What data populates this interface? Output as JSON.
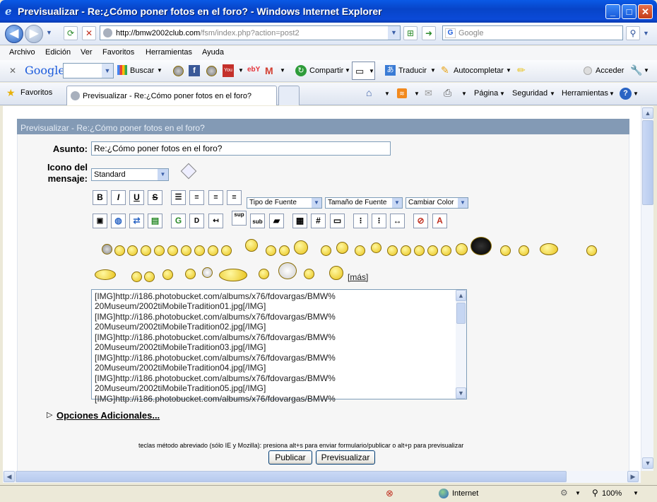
{
  "window": {
    "title": "Previsualizar - Re:¿Cómo poner fotos en el foro? - Windows Internet Explorer"
  },
  "address": {
    "url_host": "http://bmw2002club.com",
    "url_path": "/fsm/index.php?action=post2",
    "search_placeholder": "Google"
  },
  "menu": [
    "Archivo",
    "Edición",
    "Ver",
    "Favoritos",
    "Herramientas",
    "Ayuda"
  ],
  "google_toolbar": {
    "logo": "Google",
    "search": "Buscar",
    "share": "Compartir",
    "translate": "Traducir",
    "autofill": "Autocompletar",
    "signin": "Acceder"
  },
  "favorites_bar": {
    "favorites": "Favoritos",
    "tab_title": "Previsualizar - Re:¿Cómo poner fotos en el foro?",
    "page": "Página",
    "security": "Seguridad",
    "tools": "Herramientas"
  },
  "form": {
    "header": "Previsualizar - Re:¿Cómo poner fotos en el foro?",
    "subject_label": "Asunto:",
    "subject_value": "Re:¿Cómo poner fotos en el foro?",
    "icon_label_1": "Icono del",
    "icon_label_2": "mensaje:",
    "icon_value": "Standard",
    "font_type": "Tipo de Fuente",
    "font_size": "Tamaño de Fuente",
    "font_color": "Cambiar Color",
    "more_smileys": "[más]",
    "message_lines": [
      "[IMG]http://i186.photobucket.com/albums/x76/fdovargas/BMW%",
      "20Museum/2002tiMobileTradition01.jpg[/IMG]",
      "[IMG]http://i186.photobucket.com/albums/x76/fdovargas/BMW%",
      "20Museum/2002tiMobileTradition02.jpg[/IMG]",
      "[IMG]http://i186.photobucket.com/albums/x76/fdovargas/BMW%",
      "20Museum/2002tiMobileTradition03.jpg[/IMG]",
      "[IMG]http://i186.photobucket.com/albums/x76/fdovargas/BMW%",
      "20Museum/2002tiMobileTradition04.jpg[/IMG]",
      "[IMG]http://i186.photobucket.com/albums/x76/fdovargas/BMW%",
      "20Museum/2002tiMobileTradition05.jpg[/IMG]",
      "[IMG]http://i186.photobucket.com/albums/x76/fdovargas/BMW%"
    ],
    "additional_options": "Opciones Adicionales...",
    "shortcut_hint": "teclas método abreviado (sólo IE y Mozilla): presiona alt+s para enviar formulario/publicar o alt+p para previsualizar",
    "publish": "Publicar",
    "preview": "Previsualizar"
  },
  "statusbar": {
    "zone": "Internet",
    "zoom": "100%"
  }
}
